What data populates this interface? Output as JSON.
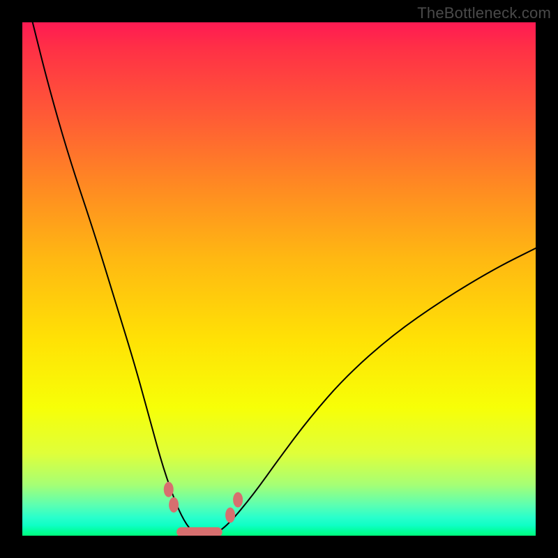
{
  "watermark": "TheBottleneck.com",
  "colors": {
    "frame": "#000000",
    "gradient_top": "#ff1a53",
    "gradient_bottom": "#00ff7e",
    "curve": "#000000",
    "marker": "#d76f6f"
  },
  "chart_data": {
    "type": "line",
    "title": "",
    "xlabel": "",
    "ylabel": "",
    "xlim": [
      0,
      100
    ],
    "ylim": [
      0,
      100
    ],
    "series": [
      {
        "name": "bottleneck-curve",
        "x": [
          2,
          5,
          9,
          14,
          18,
          22,
          25,
          27.5,
          30,
          32,
          34,
          37,
          40,
          45,
          50,
          56,
          63,
          72,
          82,
          92,
          100
        ],
        "values": [
          100,
          88,
          74,
          59,
          46,
          33,
          22,
          13,
          6,
          2,
          0,
          0,
          2,
          8,
          15,
          23,
          31,
          39,
          46,
          52,
          56
        ]
      }
    ],
    "markers": [
      {
        "x": 28.5,
        "y": 9
      },
      {
        "x": 29.5,
        "y": 6
      },
      {
        "x": 40.5,
        "y": 4
      },
      {
        "x": 42.0,
        "y": 7
      }
    ],
    "flat_bottom_segment": {
      "x_start": 31,
      "x_end": 38,
      "y": 0.7
    },
    "annotations": []
  }
}
